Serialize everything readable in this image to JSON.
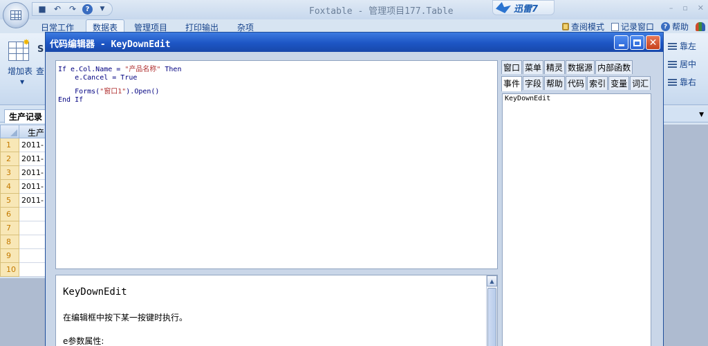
{
  "app": {
    "title": "Foxtable - 管理项目177.Table",
    "xunlei_label": "迅雷7",
    "window_controls": [
      "–",
      "▫",
      "✕"
    ]
  },
  "ribbon": {
    "tabs": [
      "日常工作",
      "数据表",
      "管理项目",
      "打印输出",
      "杂项"
    ],
    "active_tab": "数据表",
    "right_items": [
      "查阅模式",
      "记录窗口",
      "帮助"
    ],
    "add_table_label": "增加表",
    "partial_label": "查",
    "partial_s": "S",
    "align_items": [
      "靠左",
      "居中",
      "靠右"
    ]
  },
  "sheet": {
    "tab_label": "生产记录",
    "column_header": "生产",
    "rows": [
      {
        "num": "1",
        "value": "2011-"
      },
      {
        "num": "2",
        "value": "2011-"
      },
      {
        "num": "3",
        "value": "2011-"
      },
      {
        "num": "4",
        "value": "2011-"
      },
      {
        "num": "5",
        "value": "2011-"
      },
      {
        "num": "6",
        "value": ""
      },
      {
        "num": "7",
        "value": ""
      },
      {
        "num": "8",
        "value": ""
      },
      {
        "num": "9",
        "value": ""
      },
      {
        "num": "10",
        "value": ""
      }
    ]
  },
  "dialog": {
    "title": "代码编辑器 - KeyDownEdit",
    "code": {
      "line1_a": "If e.Col.Name = ",
      "line1_str": "\"产品名称\"",
      "line1_b": " Then",
      "line2": "    e.Cancel = True",
      "line3_a": "    Forms(",
      "line3_str": "\"窗口1\"",
      "line3_b": ").Open()",
      "line4": "End If"
    },
    "help": {
      "title": "KeyDownEdit",
      "description": "在编辑框中按下某一按键时执行。",
      "param_heading": "e参数属性:"
    },
    "tabs_row1": [
      "窗口",
      "菜单",
      "精灵",
      "数据源",
      "内部函数"
    ],
    "tabs_row2": [
      "事件",
      "字段",
      "帮助",
      "代码",
      "索引",
      "变量",
      "词汇"
    ],
    "active_tab": "事件",
    "list_items": [
      "KeyDownEdit"
    ]
  }
}
